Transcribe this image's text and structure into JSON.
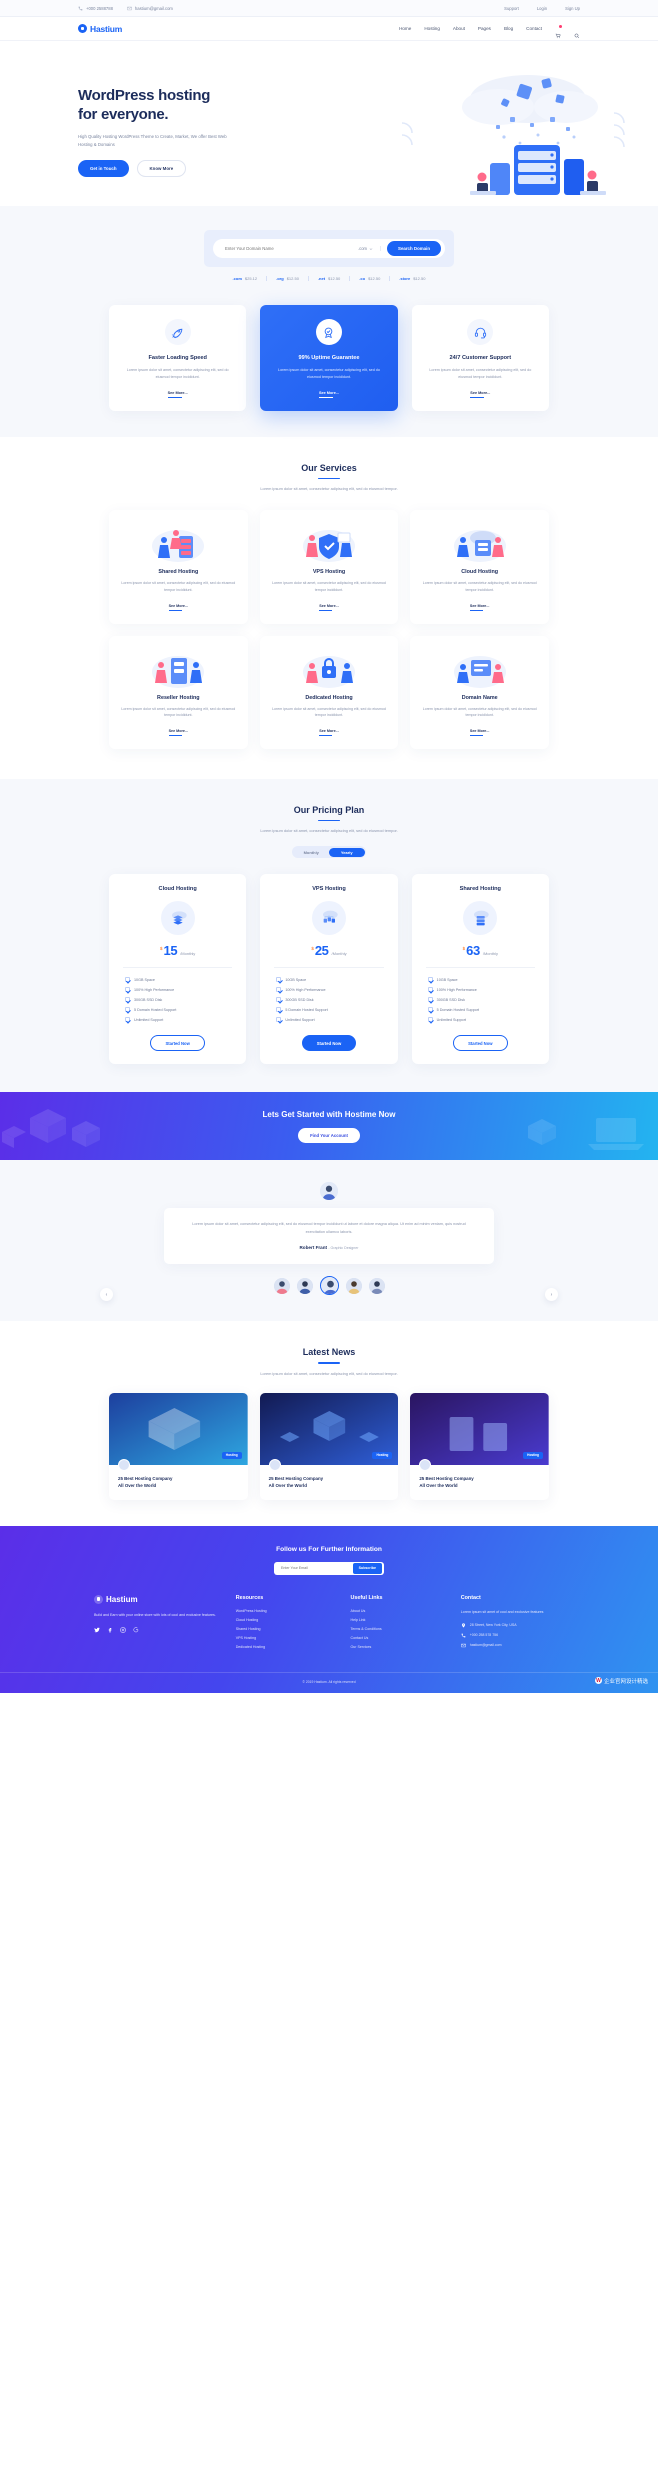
{
  "topbar": {
    "phone": "+000 2588788",
    "email": "hastium@gmail.com",
    "support": "Support",
    "login": "Login",
    "signup": "Sign Up"
  },
  "nav": {
    "brand": "Hastium",
    "links": [
      "Home",
      "Hosting",
      "About",
      "Pages",
      "Blog",
      "Contact"
    ],
    "cart_count": "0"
  },
  "hero": {
    "title_line1": "WordPress hosting",
    "title_line2": "for everyone.",
    "desc": "High Quality Hosting WordPress Theme to Create, Market, We offer Best Web Hosting & Domains",
    "btn_primary": "Get in Touch",
    "btn_secondary": "Know More"
  },
  "search": {
    "placeholder": "Enter Your Domain Name",
    "tld_selected": ".com",
    "button": "Search Domain",
    "tlds": [
      {
        "name": ".com",
        "price": "$25.12"
      },
      {
        "name": ".org",
        "price": "$12.50"
      },
      {
        "name": ".net",
        "price": "$12.50"
      },
      {
        "name": ".co",
        "price": "$12.50"
      },
      {
        "name": ".store",
        "price": "$12.50"
      }
    ]
  },
  "features": [
    {
      "icon": "rocket-icon",
      "title": "Faster Loading Speed",
      "desc": "Lorem ipsum dolor sit amet, consectetur adipiscing elit, sed do eiusmod tempor incididunt.",
      "link": "See More..."
    },
    {
      "icon": "badge-check-icon",
      "title": "99% Uptime Guarantee",
      "desc": "Lorem ipsum dolor sit amet, consectetur adipiscing elit, sed do eiusmod tempor incididunt.",
      "link": "See More..."
    },
    {
      "icon": "headset-support-icon",
      "title": "24/7 Customer Support",
      "desc": "Lorem ipsum dolor sit amet, consectetur adipiscing elit, sed do eiusmod tempor incididunt.",
      "link": "See More..."
    }
  ],
  "services": {
    "title": "Our Services",
    "subtitle": "Lorem ipsum dolor sit amet, consectetur adipiscing elit, sed do eiusmod tempor.",
    "items": [
      {
        "title": "Shared Hosting",
        "desc": "Lorem ipsum dolor sit amet, consectetur adipiscing elit, sed do eiusmod tempor incididunt.",
        "link": "See More..."
      },
      {
        "title": "VPS Hosting",
        "desc": "Lorem ipsum dolor sit amet, consectetur adipiscing elit, sed do eiusmod tempor incididunt.",
        "link": "See More..."
      },
      {
        "title": "Cloud Hosting",
        "desc": "Lorem ipsum dolor sit amet, consectetur adipiscing elit, sed do eiusmod tempor incididunt.",
        "link": "See More..."
      },
      {
        "title": "Reseller Hosting",
        "desc": "Lorem ipsum dolor sit amet, consectetur adipiscing elit, sed do eiusmod tempor incididunt.",
        "link": "See More..."
      },
      {
        "title": "Dedicated Hosting",
        "desc": "Lorem ipsum dolor sit amet, consectetur adipiscing elit, sed do eiusmod tempor incididunt.",
        "link": "See More..."
      },
      {
        "title": "Domain Name",
        "desc": "Lorem ipsum dolor sit amet, consectetur adipiscing elit, sed do eiusmod tempor incididunt.",
        "link": "See More..."
      }
    ]
  },
  "pricing": {
    "title": "Our Pricing Plan",
    "subtitle": "Lorem ipsum dolor sit amet, consectetur adipiscing elit, sed do eiusmod tempor.",
    "toggle": {
      "monthly": "Monthly",
      "yearly": "Yearly",
      "active": "Yearly"
    },
    "plans": [
      {
        "name": "Cloud Hosting",
        "currency": "$",
        "amount": "15",
        "period": "/Monthly",
        "features": [
          "10GB Space",
          "100% High Performance",
          "300GB SSD Disk",
          "5 Domain Hosted Support",
          "Unlimited Support"
        ],
        "button": "Started Now",
        "filled": false
      },
      {
        "name": "VPS Hosting",
        "currency": "$",
        "amount": "25",
        "period": "/Monthly",
        "features": [
          "10GB Space",
          "100% High Performance",
          "300GB SSD Disk",
          "5 Domain Hosted Support",
          "Unlimited Support"
        ],
        "button": "Started Now",
        "filled": true
      },
      {
        "name": "Shared Hosting",
        "currency": "$",
        "amount": "63",
        "period": "/Monthly",
        "features": [
          "10GB Space",
          "100% High Performance",
          "300GB SSD Disk",
          "5 Domain Hosted Support",
          "Unlimited Support"
        ],
        "button": "Started Now",
        "filled": false
      }
    ]
  },
  "cta": {
    "title": "Lets Get Started with Hostime Now",
    "button": "Find Your Account"
  },
  "testimonial": {
    "text": "Lorem ipsum dolor sit amet, consectetur adipiscing elit, sed do eiusmod tempor incididunt ut labore et dolore magna aliqua. Ut enim ad minim veniam, quis nostrud exercitation ullamco laboris.",
    "name": "Robert Frant",
    "role": "- Graphic Designer"
  },
  "news": {
    "title": "Latest News",
    "subtitle": "Lorem ipsum dolor sit amet, consectetur adipiscing elit, sed do eiusmod tempor.",
    "items": [
      {
        "tag": "Hosting",
        "title_line1": "25 Best Hosting Company",
        "title_line2": "All Over the World"
      },
      {
        "tag": "Hosting",
        "title_line1": "25 Best Hosting Company",
        "title_line2": "All Over the World"
      },
      {
        "tag": "Hosting",
        "title_line1": "25 Best Hosting Company",
        "title_line2": "All Over the World"
      }
    ]
  },
  "footer": {
    "follow_title": "Follow us For Further Information",
    "email_placeholder": "Enter Your Email",
    "subscribe": "Subscribe",
    "brand": "Hastium",
    "about": "Build and Earn with your online store with lots of cool and exclusive features.",
    "socials": [
      "twitter-icon",
      "facebook-icon",
      "instagram-icon",
      "google-plus-icon"
    ],
    "resources": {
      "heading": "Resources",
      "items": [
        "WordPress Hosting",
        "Cloud Hosting",
        "Shared Hosting",
        "VPS Hosting",
        "Dedicated Hosting"
      ]
    },
    "useful": {
      "heading": "Useful Links",
      "items": [
        "About Us",
        "Help Link",
        "Terms & Conditions",
        "Contact Us",
        "Our Services"
      ]
    },
    "contact": {
      "heading": "Contact",
      "note": "Lorem ipsum sit amet of cool and exclusive features",
      "address": "28 Street, New York City, USA",
      "phone": "+000 258 578 756",
      "email": "hastium@gmail.com"
    },
    "copyright": "© 2019 Hastium. All rights reserved",
    "watermark": "企业官网设计精选"
  },
  "colors": {
    "primary": "#1a63f5",
    "dark": "#1c2c5b",
    "muted": "#8b95ad",
    "accent_orange": "#ff8a3c",
    "badge_red": "#ff3d71"
  }
}
